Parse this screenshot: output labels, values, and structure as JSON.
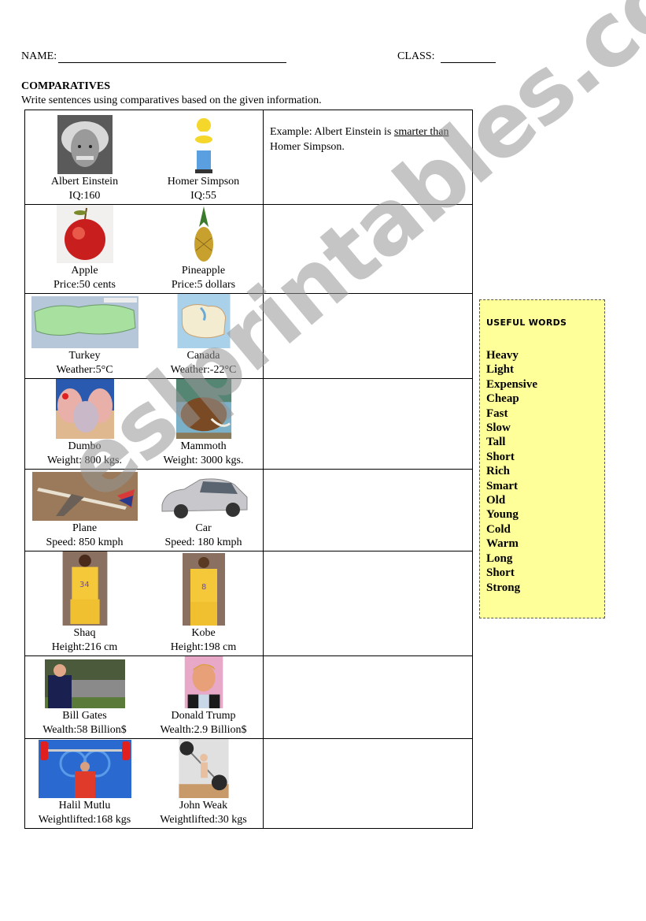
{
  "header": {
    "name_label": "NAME:",
    "class_label": "CLASS:"
  },
  "title": "COMPARATIVES",
  "instruction": "Write sentences using comparatives based on the given information.",
  "rows": [
    {
      "left": {
        "name": "Albert Einstein",
        "info": "IQ:160",
        "picture": "einstein-photo"
      },
      "right": {
        "name": "Homer Simpson",
        "info": "IQ:55",
        "picture": "homer-simpson-cartoon"
      },
      "answer": {
        "prefix": "Example: Albert Einstein is ",
        "underlined": "smarter than",
        "suffix": " Homer Simpson."
      }
    },
    {
      "left": {
        "name": "Apple",
        "info": "Price:50 cents",
        "picture": "apple-photo"
      },
      "right": {
        "name": "Pineapple",
        "info": "Price:5 dollars",
        "picture": "pineapple-photo"
      }
    },
    {
      "left": {
        "name": "Turkey",
        "info": "Weather:5°C",
        "picture": "turkey-map"
      },
      "right": {
        "name": "Canada",
        "info": "Weather:-22°C",
        "picture": "canada-map"
      }
    },
    {
      "left": {
        "name": "Dumbo",
        "info": "Weight: 800 kgs.",
        "picture": "dumbo-cartoon"
      },
      "right": {
        "name": "Mammoth",
        "info": "Weight: 3000 kgs.",
        "picture": "mammoth-cartoon"
      }
    },
    {
      "left": {
        "name": "Plane",
        "info": "Speed: 850 kmph",
        "picture": "plane-photo"
      },
      "right": {
        "name": "Car",
        "info": "Speed: 180 kmph",
        "picture": "car-photo"
      }
    },
    {
      "left": {
        "name": "Shaq",
        "info": "Height:216 cm",
        "picture": "shaq-photo"
      },
      "right": {
        "name": "Kobe",
        "info": "Height:198 cm",
        "picture": "kobe-photo"
      }
    },
    {
      "left": {
        "name": "Bill Gates",
        "info": "Wealth:58 Billion$",
        "picture": "bill-gates-photo"
      },
      "right": {
        "name": "Donald Trump",
        "info": "Wealth:2.9 Billion$",
        "picture": "donald-trump-photo"
      }
    },
    {
      "left": {
        "name": "Halil Mutlu",
        "info": "Weightlifted:168 kgs",
        "picture": "weightlifter-photo"
      },
      "right": {
        "name": "John Weak",
        "info": "Weightlifted:30 kgs",
        "picture": "weak-man-cartoon"
      }
    }
  ],
  "useful_words": {
    "title": "USEFUL WORDS",
    "items": [
      "Heavy",
      "Light",
      "Expensive",
      "Cheap",
      "Fast",
      "Slow",
      "Tall",
      "Short",
      "Rich",
      "Smart",
      "Old",
      "Young",
      "Cold",
      "Warm",
      "Long",
      "Short",
      "Strong"
    ],
    "background": "#ffff99"
  },
  "watermark": "eslprintables.com"
}
